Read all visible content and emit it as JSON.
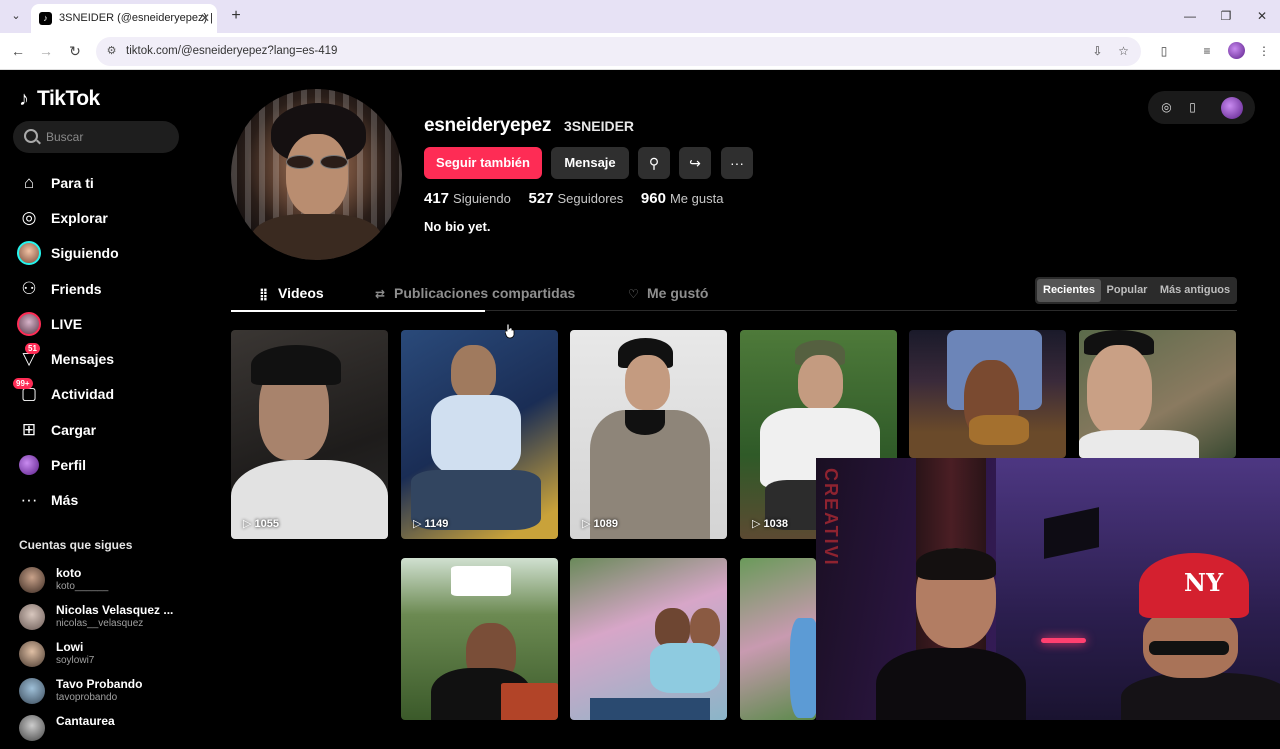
{
  "browser": {
    "tab_title": "3SNEIDER (@esneideryepez) | T",
    "tab_close": "✕",
    "new_tab": "+",
    "url": "tiktok.com/@esneideryepez?lang=es-419",
    "window_min": "—",
    "window_max": "❐",
    "window_close": "✕"
  },
  "sidebar": {
    "logo_text": "TikTok",
    "search_placeholder": "Buscar",
    "nav": [
      {
        "label": "Para ti",
        "icon": "home-icon"
      },
      {
        "label": "Explorar",
        "icon": "compass-icon"
      },
      {
        "label": "Siguiendo",
        "icon": "following-avatar-icon"
      },
      {
        "label": "Friends",
        "icon": "friends-icon"
      },
      {
        "label": "LIVE",
        "icon": "live-icon"
      },
      {
        "label": "Mensajes",
        "icon": "messages-icon",
        "badge": "51"
      },
      {
        "label": "Actividad",
        "icon": "activity-icon",
        "badge": "99+"
      },
      {
        "label": "Cargar",
        "icon": "upload-icon"
      },
      {
        "label": "Perfil",
        "icon": "profile-icon"
      },
      {
        "label": "Más",
        "icon": "more-icon"
      }
    ],
    "following_header": "Cuentas que sigues",
    "following": [
      {
        "name": "koto",
        "user": "koto______"
      },
      {
        "name": "Nicolas Velasquez ...",
        "user": "nicolas__velasquez"
      },
      {
        "name": "Lowi",
        "user": "soylowi7"
      },
      {
        "name": "Tavo Probando",
        "user": "tavoprobando"
      },
      {
        "name": "Cantaurea",
        "user": ""
      }
    ]
  },
  "profile": {
    "username": "esneideryepez",
    "nickname": "3SNEIDER",
    "follow_back_label": "Seguir también",
    "message_label": "Mensaje",
    "following_count": "417",
    "following_label": "Siguiendo",
    "followers_count": "527",
    "followers_label": "Seguidores",
    "likes_count": "960",
    "likes_label": "Me gusta",
    "bio": "No bio yet."
  },
  "tabs": {
    "videos": "Videos",
    "reposts": "Publicaciones compartidas",
    "liked": "Me gustó"
  },
  "sort": {
    "recent": "Recientes",
    "popular": "Popular",
    "oldest": "Más antiguos"
  },
  "videos": [
    {
      "views": "1055"
    },
    {
      "views": "1149"
    },
    {
      "views": "1089"
    },
    {
      "views": "1038"
    },
    {
      "views": ""
    },
    {
      "views": ""
    },
    {
      "views": ""
    },
    {
      "views": ""
    },
    {
      "views": ""
    }
  ],
  "webcam": {
    "wall_text": "CREATIVI"
  },
  "colors": {
    "accent": "#fe2c55",
    "background": "#000000"
  }
}
